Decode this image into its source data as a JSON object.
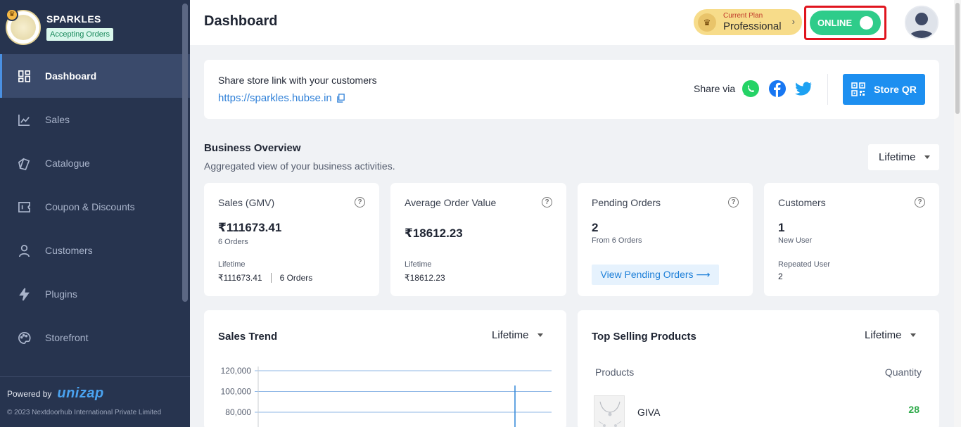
{
  "store": {
    "name": "SPARKLES",
    "status": "Accepting Orders"
  },
  "sidebar": {
    "items": [
      {
        "label": "Dashboard",
        "icon": "dashboard-icon",
        "active": true
      },
      {
        "label": "Sales",
        "icon": "chart-line-icon"
      },
      {
        "label": "Catalogue",
        "icon": "catalogue-icon"
      },
      {
        "label": "Coupon & Discounts",
        "icon": "coupon-icon"
      },
      {
        "label": "Customers",
        "icon": "user-icon"
      },
      {
        "label": "Plugins",
        "icon": "bolt-icon"
      },
      {
        "label": "Storefront",
        "icon": "palette-icon"
      }
    ],
    "powered_by": "Powered by",
    "powered_brand": "unizap",
    "copyright": "© 2023 Nextdoorhub International Private Limited"
  },
  "header": {
    "title": "Dashboard",
    "plan_label": "Current Plan",
    "plan_name": "Professional",
    "plan_chevron": "›",
    "online_label": "ONLINE"
  },
  "share": {
    "label": "Share store link with your customers",
    "link": "https://sparkles.hubse.in",
    "via": "Share via",
    "qr_label": "Store QR"
  },
  "overview": {
    "title": "Business Overview",
    "subtitle": "Aggregated view of your business activities.",
    "range": "Lifetime",
    "cards": {
      "sales": {
        "title": "Sales (GMV)",
        "value": "₹111673.41",
        "sub": "6 Orders",
        "foot_label": "Lifetime",
        "foot_value": "₹111673.41",
        "foot_value2": "6 Orders"
      },
      "aov": {
        "title": "Average Order Value",
        "value": "₹18612.23",
        "foot_label": "Lifetime",
        "foot_value": "₹18612.23"
      },
      "pending": {
        "title": "Pending Orders",
        "value": "2",
        "sub": "From 6 Orders",
        "button": "View Pending Orders ⟶"
      },
      "customers": {
        "title": "Customers",
        "value": "1",
        "sub": "New User",
        "foot_label": "Repeated User",
        "foot_value": "2"
      }
    },
    "help_symbol": "?"
  },
  "trend": {
    "title": "Sales Trend",
    "range": "Lifetime"
  },
  "chart_data": {
    "type": "line",
    "title": "Sales Trend",
    "y_ticks": [
      "120,000",
      "100,000",
      "80,000"
    ],
    "ylim": [
      80000,
      120000
    ],
    "grid": true
  },
  "top_selling": {
    "title": "Top Selling Products",
    "range": "Lifetime",
    "col_products": "Products",
    "col_quantity": "Quantity",
    "rows": [
      {
        "name": "GIVA",
        "quantity": "28"
      }
    ]
  },
  "colors": {
    "sidebar_bg": "#27344f",
    "accent": "#1d8ff0",
    "online": "#2ecc8a",
    "plan": "#f7dc8a",
    "highlight": "#e0141e"
  }
}
